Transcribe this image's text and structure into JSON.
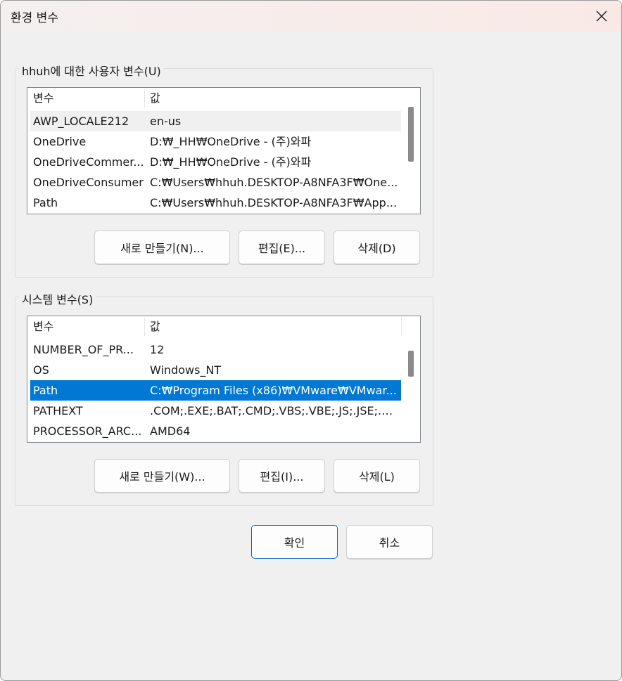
{
  "window": {
    "title": "환경 변수",
    "close_icon": "close-icon"
  },
  "user_vars": {
    "group_label": "hhuh에 대한 사용자 변수(U)",
    "columns": [
      "변수",
      "값"
    ],
    "rows": [
      {
        "name": "AWP_LOCALE212",
        "value": "en-us"
      },
      {
        "name": "OneDrive",
        "value": "D:₩_HH₩OneDrive - (주)와파"
      },
      {
        "name": "OneDriveCommer...",
        "value": "D:₩_HH₩OneDrive - (주)와파"
      },
      {
        "name": "OneDriveConsumer",
        "value": "C:₩Users₩hhuh.DESKTOP-A8NFA3F₩One..."
      },
      {
        "name": "Path",
        "value": "C:₩Users₩hhuh.DESKTOP-A8NFA3F₩App..."
      }
    ],
    "buttons": {
      "new": "새로 만들기(N)...",
      "edit": "편집(E)...",
      "delete": "삭제(D)"
    }
  },
  "system_vars": {
    "group_label": "시스템 변수(S)",
    "columns": [
      "변수",
      "값"
    ],
    "rows": [
      {
        "name": "NUMBER_OF_PR...",
        "value": "12"
      },
      {
        "name": "OS",
        "value": "Windows_NT"
      },
      {
        "name": "Path",
        "value": "C:₩Program Files (x86)₩VMware₩VMwar..."
      },
      {
        "name": "PATHEXT",
        "value": ".COM;.EXE;.BAT;.CMD;.VBS;.VBE;.JS;.JSE;.W..."
      },
      {
        "name": "PROCESSOR_ARC...",
        "value": "AMD64"
      }
    ],
    "selected_row": "Path",
    "buttons": {
      "new": "새로 만들기(W)...",
      "edit": "편집(I)...",
      "delete": "삭제(L)"
    }
  },
  "footer": {
    "ok": "확인",
    "cancel": "취소"
  },
  "colors": {
    "selection": "#0078d4",
    "accent_border": "#0067c0"
  }
}
